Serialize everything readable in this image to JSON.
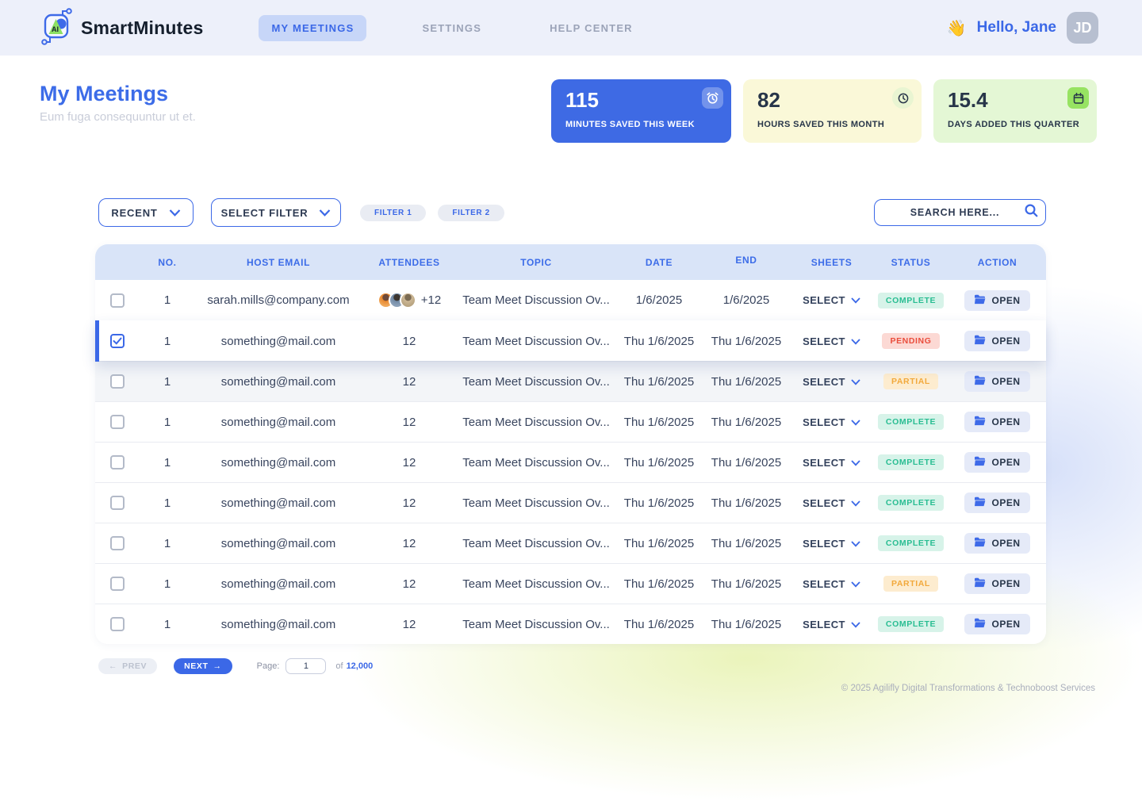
{
  "brand": {
    "name": "SmartMinutes",
    "logo_icon": "ai-circuit-logo-icon"
  },
  "nav": {
    "items": [
      {
        "label": "MY MEETINGS",
        "active": true
      },
      {
        "label": "SETTINGS",
        "active": false
      },
      {
        "label": "HELP CENTER",
        "active": false
      }
    ]
  },
  "user": {
    "greeting_emoji": "👋",
    "greeting": "Hello, Jane",
    "avatar_initials": "JD"
  },
  "page": {
    "title": "My Meetings",
    "subtitle": "Eum fuga consequuntur ut et."
  },
  "stats": [
    {
      "value": "115",
      "label": "MINUTES SAVED THIS WEEK",
      "icon": "alarm-clock-icon",
      "theme": "blue"
    },
    {
      "value": "82",
      "label": "HOURS SAVED THIS MONTH",
      "icon": "clock-icon",
      "theme": "yellow"
    },
    {
      "value": "15.4",
      "label": "DAYS ADDED THIS QUARTER",
      "icon": "calendar-icon",
      "theme": "green"
    }
  ],
  "filters": {
    "sort_dropdown": "RECENT",
    "filter_dropdown": "SELECT FILTER",
    "chips": [
      "FILTER 1",
      "FILTER 2"
    ],
    "search_placeholder": "SEARCH HERE..."
  },
  "table": {
    "columns": [
      "NO.",
      "HOST EMAIL",
      "ATTENDEES",
      "TOPIC",
      "DATE",
      "END",
      "SHEETS",
      "STATUS",
      "ACTION"
    ],
    "sheets_select_label": "SELECT",
    "open_label": "OPEN",
    "rows": [
      {
        "no": "1",
        "email": "sarah.mills@company.com",
        "attendees": "+12",
        "show_avatars": true,
        "topic": "Team Meet Discussion Ov...",
        "date": "1/6/2025",
        "end": "1/6/2025",
        "status": "COMPLETE",
        "checked": false,
        "selected": false,
        "shaded": false
      },
      {
        "no": "1",
        "email": "something@mail.com",
        "attendees": "12",
        "show_avatars": false,
        "topic": "Team Meet Discussion Ov...",
        "date": "Thu 1/6/2025",
        "end": "Thu 1/6/2025",
        "status": "PENDING",
        "checked": true,
        "selected": true,
        "shaded": false
      },
      {
        "no": "1",
        "email": "something@mail.com",
        "attendees": "12",
        "show_avatars": false,
        "topic": "Team Meet Discussion Ov...",
        "date": "Thu 1/6/2025",
        "end": "Thu 1/6/2025",
        "status": "PARTIAL",
        "checked": false,
        "selected": false,
        "shaded": true
      },
      {
        "no": "1",
        "email": "something@mail.com",
        "attendees": "12",
        "show_avatars": false,
        "topic": "Team Meet Discussion Ov...",
        "date": "Thu 1/6/2025",
        "end": "Thu 1/6/2025",
        "status": "COMPLETE",
        "checked": false,
        "selected": false,
        "shaded": false
      },
      {
        "no": "1",
        "email": "something@mail.com",
        "attendees": "12",
        "show_avatars": false,
        "topic": "Team Meet Discussion Ov...",
        "date": "Thu 1/6/2025",
        "end": "Thu 1/6/2025",
        "status": "COMPLETE",
        "checked": false,
        "selected": false,
        "shaded": false
      },
      {
        "no": "1",
        "email": "something@mail.com",
        "attendees": "12",
        "show_avatars": false,
        "topic": "Team Meet Discussion Ov...",
        "date": "Thu 1/6/2025",
        "end": "Thu 1/6/2025",
        "status": "COMPLETE",
        "checked": false,
        "selected": false,
        "shaded": false
      },
      {
        "no": "1",
        "email": "something@mail.com",
        "attendees": "12",
        "show_avatars": false,
        "topic": "Team Meet Discussion Ov...",
        "date": "Thu 1/6/2025",
        "end": "Thu 1/6/2025",
        "status": "COMPLETE",
        "checked": false,
        "selected": false,
        "shaded": false
      },
      {
        "no": "1",
        "email": "something@mail.com",
        "attendees": "12",
        "show_avatars": false,
        "topic": "Team Meet Discussion Ov...",
        "date": "Thu 1/6/2025",
        "end": "Thu 1/6/2025",
        "status": "PARTIAL",
        "checked": false,
        "selected": false,
        "shaded": false
      },
      {
        "no": "1",
        "email": "something@mail.com",
        "attendees": "12",
        "show_avatars": false,
        "topic": "Team Meet Discussion Ov...",
        "date": "Thu 1/6/2025",
        "end": "Thu 1/6/2025",
        "status": "COMPLETE",
        "checked": false,
        "selected": false,
        "shaded": false
      }
    ]
  },
  "pagination": {
    "prev": "PREV",
    "prev_arrow": "←",
    "next": "NEXT",
    "next_arrow": "→",
    "page_label": "Page:",
    "page_value": "1",
    "of_label": "of",
    "total": "12,000"
  },
  "footer": {
    "copyright": "© 2025 Agilifly Digital Transformations & Technoboost Services"
  },
  "colors": {
    "accent": "#3b68e7",
    "header_bg": "#edf0fa",
    "table_header_bg": "#d9e4f8",
    "status_complete": "#29bd92",
    "status_pending": "#ea4d3c",
    "status_partial": "#f2a93c",
    "card_blue": "#3e6ae4",
    "card_yellow": "#faf8d8",
    "card_green": "#e4f7d5"
  }
}
